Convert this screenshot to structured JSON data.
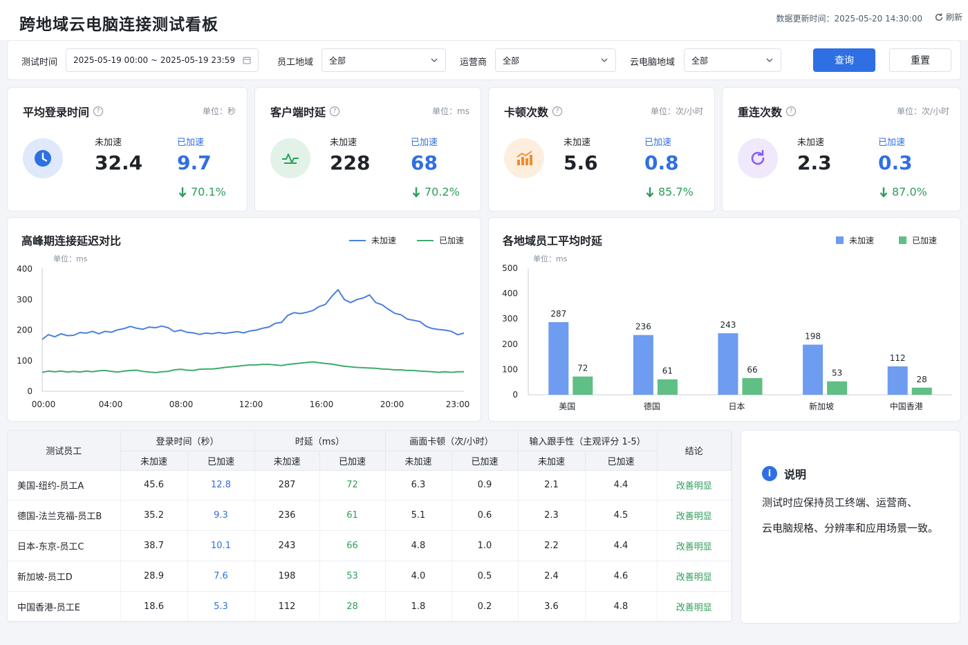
{
  "header": {
    "title": "跨地域云电脑连接测试看板",
    "update_time": "数据更新时间：2025-05-20 14:30:00",
    "refresh_label": "刷新"
  },
  "filters": {
    "time_label": "测试时间",
    "time_value": "2025-05-19 00:00 ~ 2025-05-19 23:59",
    "region_label": "员工地域",
    "region_value": "全部",
    "isp_label": "运营商",
    "isp_value": "全部",
    "cloud_label": "云电脑地域",
    "cloud_value": "全部",
    "query_label": "查询",
    "reset_label": "重置"
  },
  "kpis": [
    {
      "title": "平均登录时间",
      "unit": "单位：秒",
      "before_label": "未加速",
      "after_label": "已加速",
      "before": "32.4",
      "after": "9.7",
      "pct": "70.1%",
      "icon": "clock-icon",
      "icon_bg": "#dfe9fb",
      "icon_color": "#2f6fe4"
    },
    {
      "title": "客户端时延",
      "unit": "单位：ms",
      "before_label": "未加速",
      "after_label": "已加速",
      "before": "228",
      "after": "68",
      "pct": "70.2%",
      "icon": "pulse-icon",
      "icon_bg": "#e2f2e8",
      "icon_color": "#2e9d5a"
    },
    {
      "title": "卡顿次数",
      "unit": "单位：次/小时",
      "before_label": "未加速",
      "after_label": "已加速",
      "before": "5.6",
      "after": "0.8",
      "pct": "85.7%",
      "icon": "bar-chart-icon",
      "icon_bg": "#fdeede",
      "icon_color": "#f5892a"
    },
    {
      "title": "重连次数",
      "unit": "单位：次/小时",
      "before_label": "未加速",
      "after_label": "已加速",
      "before": "2.3",
      "after": "0.3",
      "pct": "87.0%",
      "icon": "reconnect-icon",
      "icon_bg": "#efe9fb",
      "icon_color": "#8b5cf6"
    }
  ],
  "line_chart_title": "高峰期连接延迟对比",
  "bar_chart_title": "各地域员工平均时延",
  "chart_data": [
    {
      "type": "line",
      "title": "高峰期连接延迟对比",
      "unit": "单位：ms",
      "ylim": [
        0,
        400
      ],
      "yticks": [
        0,
        100,
        200,
        300,
        400
      ],
      "xticks": [
        "00:00",
        "04:00",
        "08:00",
        "12:00",
        "16:00",
        "20:00",
        "23:00"
      ],
      "legend_position": "top-right",
      "series": [
        {
          "name": "未加速",
          "color": "#4a7fe0",
          "values": [
            170,
            185,
            178,
            188,
            182,
            183,
            192,
            190,
            196,
            188,
            196,
            193,
            201,
            205,
            212,
            206,
            203,
            210,
            208,
            213,
            208,
            195,
            200,
            193,
            191,
            186,
            190,
            188,
            192,
            189,
            192,
            195,
            191,
            197,
            200,
            206,
            210,
            222,
            225,
            248,
            257,
            254,
            258,
            264,
            277,
            284,
            310,
            332,
            300,
            290,
            300,
            305,
            315,
            290,
            283,
            268,
            255,
            250,
            236,
            232,
            228,
            212,
            205,
            202,
            200,
            196,
            185,
            190
          ]
        },
        {
          "name": "已加速",
          "color": "#3dab6a",
          "values": [
            62,
            66,
            64,
            66,
            63,
            65,
            63,
            66,
            64,
            67,
            68,
            65,
            63,
            66,
            68,
            69,
            65,
            63,
            61,
            64,
            65,
            70,
            72,
            69,
            68,
            72,
            73,
            73,
            75,
            78,
            80,
            82,
            84,
            86,
            86,
            88,
            88,
            86,
            84,
            88,
            90,
            92,
            94,
            96,
            93,
            91,
            89,
            85,
            82,
            80,
            78,
            77,
            76,
            75,
            73,
            72,
            70,
            70,
            68,
            68,
            66,
            65,
            64,
            62,
            64,
            62,
            64,
            64
          ]
        }
      ]
    },
    {
      "type": "bar",
      "title": "各地域员工平均时延",
      "unit": "单位：ms",
      "ylim": [
        0,
        500
      ],
      "yticks": [
        0,
        100,
        200,
        300,
        400,
        500
      ],
      "categories": [
        "美国",
        "德国",
        "日本",
        "新加坡",
        "中国香港"
      ],
      "legend_position": "top-right",
      "series": [
        {
          "name": "未加速",
          "color": "#6d9cf0",
          "values": [
            287,
            236,
            243,
            198,
            112
          ]
        },
        {
          "name": "已加速",
          "color": "#5fbf84",
          "values": [
            72,
            61,
            66,
            53,
            28
          ]
        }
      ]
    }
  ],
  "table": {
    "header_employee": "测试员工",
    "header_groups": [
      "登录时间（秒）",
      "时延（ms）",
      "画面卡顿（次/小时）",
      "输入跟手性（主观评分 1-5）"
    ],
    "header_conclusion": "结论",
    "sub_before": "未加速",
    "sub_after": "已加速",
    "rows": [
      {
        "employee": "美国-纽约-员工A",
        "login_b": "45.6",
        "login_a": "12.8",
        "lat_b": "287",
        "lat_a": "72",
        "stut_b": "6.3",
        "stut_a": "0.9",
        "input_b": "2.1",
        "input_a": "4.4",
        "result": "改善明显"
      },
      {
        "employee": "德国-法兰克福-员工B",
        "login_b": "35.2",
        "login_a": "9.3",
        "lat_b": "236",
        "lat_a": "61",
        "stut_b": "5.1",
        "stut_a": "0.6",
        "input_b": "2.3",
        "input_a": "4.5",
        "result": "改善明显"
      },
      {
        "employee": "日本-东京-员工C",
        "login_b": "38.7",
        "login_a": "10.1",
        "lat_b": "243",
        "lat_a": "66",
        "stut_b": "4.8",
        "stut_a": "1.0",
        "input_b": "2.2",
        "input_a": "4.4",
        "result": "改善明显"
      },
      {
        "employee": "新加坡-员工D",
        "login_b": "28.9",
        "login_a": "7.6",
        "lat_b": "198",
        "lat_a": "53",
        "stut_b": "4.0",
        "stut_a": "0.5",
        "input_b": "2.4",
        "input_a": "4.6",
        "result": "改善明显"
      },
      {
        "employee": "中国香港-员工E",
        "login_b": "18.6",
        "login_a": "5.3",
        "lat_b": "112",
        "lat_a": "28",
        "stut_b": "1.8",
        "stut_a": "0.2",
        "input_b": "3.6",
        "input_a": "4.8",
        "result": "改善明显"
      }
    ]
  },
  "note": {
    "title": "说明",
    "line1": "测试时应保持员工终端、运营商、",
    "line2": "云电脑规格、分辨率和应用场景一致。"
  }
}
